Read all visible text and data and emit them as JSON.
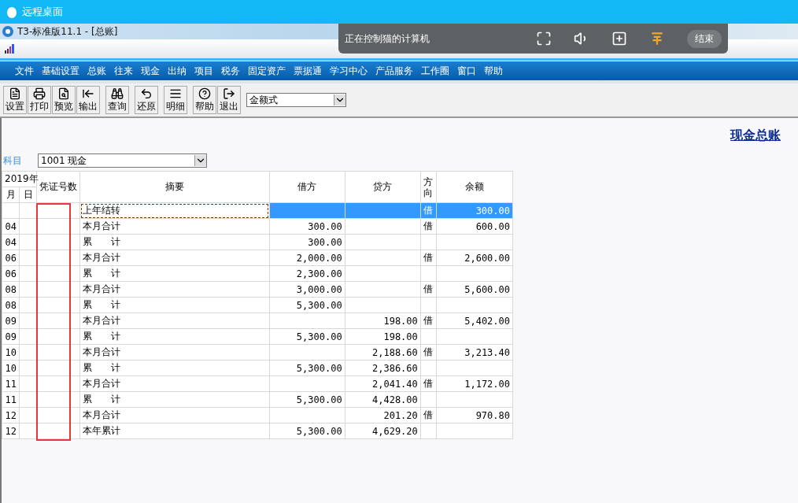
{
  "remote_window": {
    "title": "远程桌面"
  },
  "app_window": {
    "title": "T3-标准版11.1 - [总账]"
  },
  "remote_control_bar": {
    "status": "正在控制猫的计算机",
    "end_button": "结束"
  },
  "menu": [
    "文件",
    "基础设置",
    "总账",
    "往来",
    "现金",
    "出纳",
    "项目",
    "税务",
    "固定资产",
    "票据通",
    "学习中心",
    "产品服务",
    "工作圈",
    "窗口",
    "帮助"
  ],
  "toolbar": [
    {
      "label": "设置",
      "kind": "setup"
    },
    {
      "label": "打印",
      "kind": "print"
    },
    {
      "label": "预览",
      "kind": "preview"
    },
    {
      "label": "输出",
      "kind": "export"
    },
    {
      "label": "查询",
      "kind": "query"
    },
    {
      "label": "还原",
      "kind": "restore"
    },
    {
      "label": "明细",
      "kind": "detail"
    },
    {
      "label": "帮助",
      "kind": "help"
    },
    {
      "label": "退出",
      "kind": "exit"
    }
  ],
  "format_select": {
    "value": "金额式"
  },
  "report_title": "现金总账",
  "account": {
    "label": "科目",
    "value": "1001 现金"
  },
  "table": {
    "year": "2019年",
    "columns": [
      "月",
      "日",
      "凭证号数",
      "摘要",
      "借方",
      "贷方",
      "方向",
      "余额"
    ],
    "rows": [
      {
        "month": "",
        "summary": "上年结转",
        "debit": "",
        "credit": "",
        "direction": "借",
        "balance": "300.00",
        "selected": true
      },
      {
        "month": "04",
        "summary": "本月合计",
        "debit": "300.00",
        "credit": "",
        "direction": "借",
        "balance": "600.00",
        "selected": false
      },
      {
        "month": "04",
        "summary": "累　　计",
        "debit": "300.00",
        "credit": "",
        "direction": "",
        "balance": "",
        "selected": false
      },
      {
        "month": "06",
        "summary": "本月合计",
        "debit": "2,000.00",
        "credit": "",
        "direction": "借",
        "balance": "2,600.00",
        "selected": false
      },
      {
        "month": "06",
        "summary": "累　　计",
        "debit": "2,300.00",
        "credit": "",
        "direction": "",
        "balance": "",
        "selected": false
      },
      {
        "month": "08",
        "summary": "本月合计",
        "debit": "3,000.00",
        "credit": "",
        "direction": "借",
        "balance": "5,600.00",
        "selected": false
      },
      {
        "month": "08",
        "summary": "累　　计",
        "debit": "5,300.00",
        "credit": "",
        "direction": "",
        "balance": "",
        "selected": false
      },
      {
        "month": "09",
        "summary": "本月合计",
        "debit": "",
        "credit": "198.00",
        "direction": "借",
        "balance": "5,402.00",
        "selected": false
      },
      {
        "month": "09",
        "summary": "累　　计",
        "debit": "5,300.00",
        "credit": "198.00",
        "direction": "",
        "balance": "",
        "selected": false
      },
      {
        "month": "10",
        "summary": "本月合计",
        "debit": "",
        "credit": "2,188.60",
        "direction": "借",
        "balance": "3,213.40",
        "selected": false
      },
      {
        "month": "10",
        "summary": "累　　计",
        "debit": "5,300.00",
        "credit": "2,386.60",
        "direction": "",
        "balance": "",
        "selected": false
      },
      {
        "month": "11",
        "summary": "本月合计",
        "debit": "",
        "credit": "2,041.40",
        "direction": "借",
        "balance": "1,172.00",
        "selected": false
      },
      {
        "month": "11",
        "summary": "累　　计",
        "debit": "5,300.00",
        "credit": "4,428.00",
        "direction": "",
        "balance": "",
        "selected": false
      },
      {
        "month": "12",
        "summary": "本月合计",
        "debit": "",
        "credit": "201.20",
        "direction": "借",
        "balance": "970.80",
        "selected": false
      },
      {
        "month": "12",
        "summary": "本年累计",
        "debit": "5,300.00",
        "credit": "4,629.20",
        "direction": "",
        "balance": "",
        "selected": false
      }
    ]
  }
}
